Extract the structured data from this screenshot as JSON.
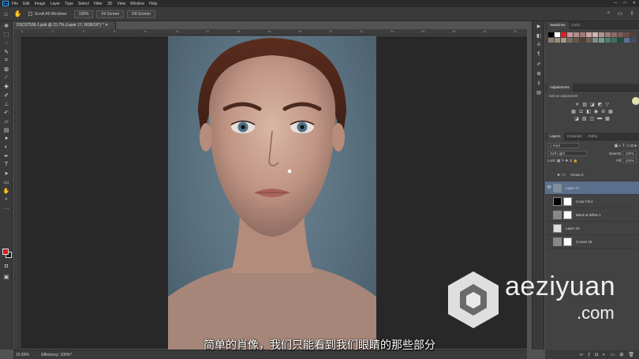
{
  "menu": {
    "items": [
      "File",
      "Edit",
      "Image",
      "Layer",
      "Type",
      "Select",
      "Filter",
      "3D",
      "View",
      "Window",
      "Help"
    ]
  },
  "options_bar": {
    "scroll_all_windows": "Scroll All Windows",
    "zoom_pct": "100%",
    "fit_screen": "Fit Screen",
    "fill_screen": "Fill Screen"
  },
  "document": {
    "tab_title": "DSC07536-1.psb @ 15.7% (Layer 17, RGB/16*) *",
    "ruler_ticks": [
      "0",
      "2",
      "4",
      "6",
      "8",
      "10",
      "12",
      "14",
      "16",
      "18",
      "20",
      "22",
      "24",
      "26",
      "28",
      "30",
      "32"
    ]
  },
  "status": {
    "zoom": "15.69%",
    "efficiency": "Efficiency: 100%*"
  },
  "caption": "简单的肖像，我们只能看到我们眼睛的那些部分",
  "panels": {
    "swatches_tab": "Swatches",
    "color_tab": "Color",
    "adjustments_tab": "Adjustments",
    "add_adjustment": "Add an adjustment",
    "layers_tab": "Layers",
    "channels_tab": "Channels",
    "paths_tab": "Paths",
    "kind": "Kind",
    "blend_mode": "Soft Light",
    "opacity_label": "Opacity:",
    "opacity_value": "100%",
    "lock_label": "Lock:",
    "fill_label": "Fill:",
    "fill_value": "100%"
  },
  "layers": [
    {
      "name": "Group 2",
      "type": "group",
      "visible": false,
      "selected": false
    },
    {
      "name": "Layer 17",
      "type": "pixel",
      "visible": true,
      "selected": true,
      "thumb": "#7d8f9a"
    },
    {
      "name": "Color Fill 4",
      "type": "fill",
      "visible": false,
      "selected": false,
      "thumb": "#000000",
      "mask": "#ffffff"
    },
    {
      "name": "Black & White 1",
      "type": "adjustment",
      "visible": false,
      "selected": false,
      "thumb": "#888888",
      "mask": "#ffffff"
    },
    {
      "name": "Layer 16",
      "type": "pixel",
      "visible": false,
      "selected": false,
      "thumb": "#dddddd"
    },
    {
      "name": "Curves 15",
      "type": "adjustment",
      "visible": false,
      "selected": false,
      "thumb": "#888888",
      "mask": "#ffffff"
    }
  ],
  "watermark": {
    "text": "aeziyuan",
    "suffix": ".com"
  },
  "swatch_colors": [
    "#000000",
    "#ffffff",
    "#e51c23",
    "#c49a9a",
    "#b58c8c",
    "#a07878",
    "#c6a5a5",
    "#d4b3b3",
    "#b5938f",
    "#9d7b76",
    "#8c6a66",
    "#7b5c58",
    "#6a4d49",
    "#593e3b",
    "#8c7d70",
    "#9c8a7b",
    "#a89584",
    "#7a6a5e",
    "#66584e",
    "#4f4339",
    "#706050",
    "#7f8f7f",
    "#6f9f8f",
    "#4f7f6f",
    "#3f6f5f",
    "#2a4a3a",
    "#5f6f8f",
    "#3f4f6f"
  ]
}
